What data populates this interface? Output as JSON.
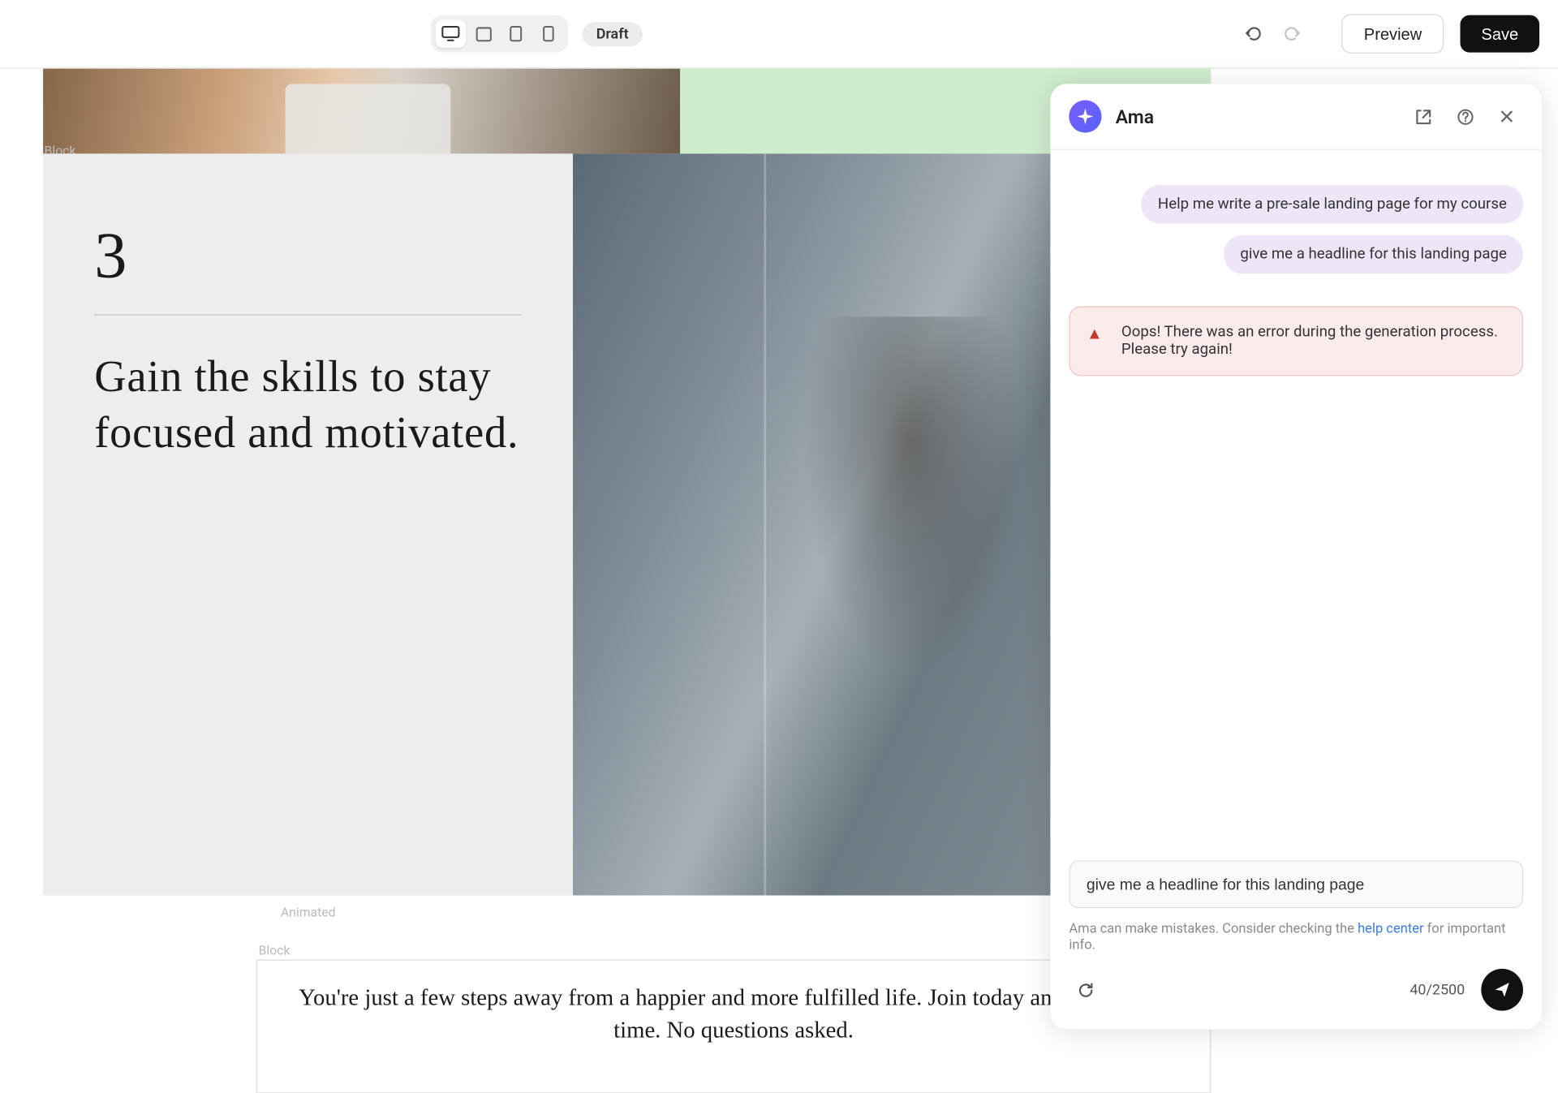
{
  "toolbar": {
    "status_badge": "Draft",
    "preview_label": "Preview",
    "save_label": "Save"
  },
  "canvas": {
    "block_label": "Block",
    "animated_label": "Animated",
    "card": {
      "number": "3",
      "heading": "Gain the skills to stay focused and motivated."
    },
    "bottom_text": "You're just a few steps away from a happier and more fulfilled life. Join today and cancel any time. No questions asked."
  },
  "ai": {
    "title": "Ama",
    "messages": {
      "user1": "Help me write a pre-sale landing page for my course",
      "user2": "give me a headline for this landing page"
    },
    "error": "Oops! There was an error during the generation process. Please try again!",
    "input_value": "give me a headline for this landing page",
    "disclaimer_prefix": "Ama can make mistakes. Consider checking the ",
    "disclaimer_link": "help center",
    "disclaimer_suffix": " for important info.",
    "char_count": "40/2500"
  }
}
